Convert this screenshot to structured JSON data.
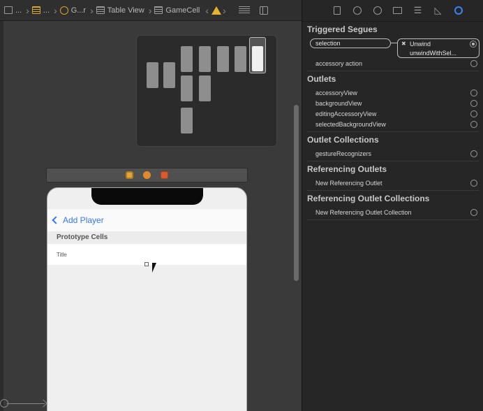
{
  "jumpbar": {
    "crumbs": [
      "...",
      "...",
      "G...r",
      "Table View",
      "GameCell"
    ]
  },
  "canvas": {
    "nav_back_label": "Add Player",
    "section_header": "Prototype Cells",
    "cell_title": "Title"
  },
  "inspector": {
    "tabs": [
      "file-icon",
      "history-icon",
      "help-icon",
      "identity-icon",
      "attributes-icon",
      "size-icon",
      "connections-icon"
    ],
    "triggered_segues": {
      "title": "Triggered Segues",
      "selection_label": "selection",
      "unwind_line1": "Unwind",
      "unwind_line2": "unwindWithSel...",
      "accessory_action": "accessory action"
    },
    "outlets": {
      "title": "Outlets",
      "items": [
        "accessoryView",
        "backgroundView",
        "editingAccessoryView",
        "selectedBackgroundView"
      ]
    },
    "outlet_collections": {
      "title": "Outlet Collections",
      "items": [
        "gestureRecognizers"
      ]
    },
    "referencing_outlets": {
      "title": "Referencing Outlets",
      "items": [
        "New Referencing Outlet"
      ]
    },
    "referencing_outlet_collections": {
      "title": "Referencing Outlet Collections",
      "items": [
        "New Referencing Outlet Collection"
      ]
    }
  },
  "colors": {
    "accent": "#3478f6",
    "warning": "#e6b42c"
  }
}
